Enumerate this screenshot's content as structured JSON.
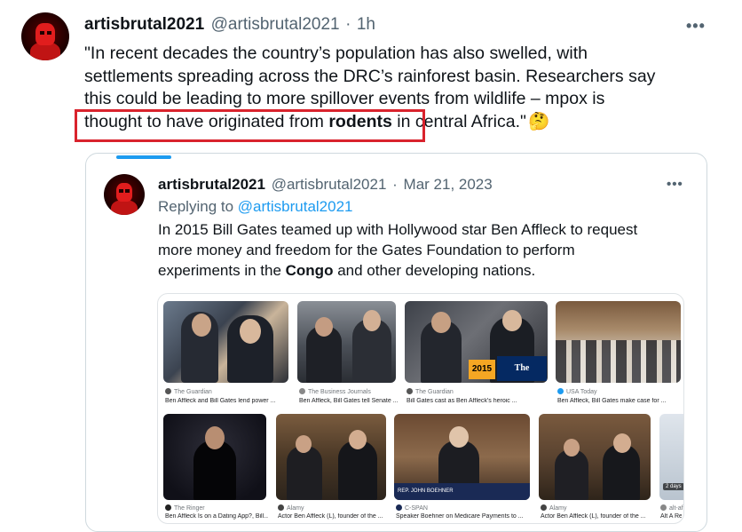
{
  "tweet": {
    "display_name": "artisbrutal2021",
    "handle": "@artisbrutal2021",
    "separator": "·",
    "time": "1h",
    "more": "•••",
    "line1": "\"In recent decades the country’s population has also swelled, with",
    "line2": "settlements spreading across the DRC’s rainforest basin. Researchers say",
    "line3": "this could be leading to more spillover events from wildlife – mpox is",
    "line4_a": "thought to have originated from ",
    "line4_bold": "rodents",
    "line4_b": " in central Africa.\"",
    "emoji": "🤔"
  },
  "quoted": {
    "display_name": "artisbrutal2021",
    "handle": "@artisbrutal2021",
    "separator": "·",
    "date": "Mar 21, 2023",
    "more": "•••",
    "replying_prefix": "Replying to ",
    "replying_handle": "@artisbrutal2021",
    "line1": "In 2015 Bill Gates teamed up with Hollywood star Ben Affleck to request",
    "line2": "more money and freedom for the Gates Foundation to perform",
    "line3_a": "experiments in the ",
    "line3_bold": "Congo",
    "line3_b": " and other developing nations."
  },
  "gallery": {
    "row1": [
      {
        "source": "The Guardian",
        "caption": "Ben Affleck and Bill Gates lend power ..."
      },
      {
        "source": "The Business Journals",
        "caption": "Ben Affleck, Bill Gates tell Senate ..."
      },
      {
        "source": "The Guardian",
        "caption": "Bill Gates cast as Ben Affleck's heroic ...",
        "overlay_year": "2015",
        "overlay_brand": "The Guardian"
      },
      {
        "source": "USA Today",
        "caption": "Ben Affleck, Bill Gates make case for ..."
      }
    ],
    "row2": [
      {
        "source": "The Ringer",
        "caption": "Ben Affleck Is on a Dating App?, Bill..."
      },
      {
        "source": "Alamy",
        "caption": "Actor Ben Affleck (L), founder of the ..."
      },
      {
        "source": "C-SPAN",
        "caption": "Speaker Boehner on Medicare Payments to ..."
      },
      {
        "source": "Alamy",
        "caption": "Actor Ben Affleck (L), founder of the ..."
      },
      {
        "source": "alt-af",
        "caption": "Alt A Re",
        "overlay_days": "2 days"
      }
    ],
    "cspan_banner": "REP. JOHN BOEHNER"
  },
  "colors": {
    "accent": "#1d9bf0",
    "highlight": "#d9232d",
    "text": "#0f1419",
    "muted": "#536471"
  }
}
